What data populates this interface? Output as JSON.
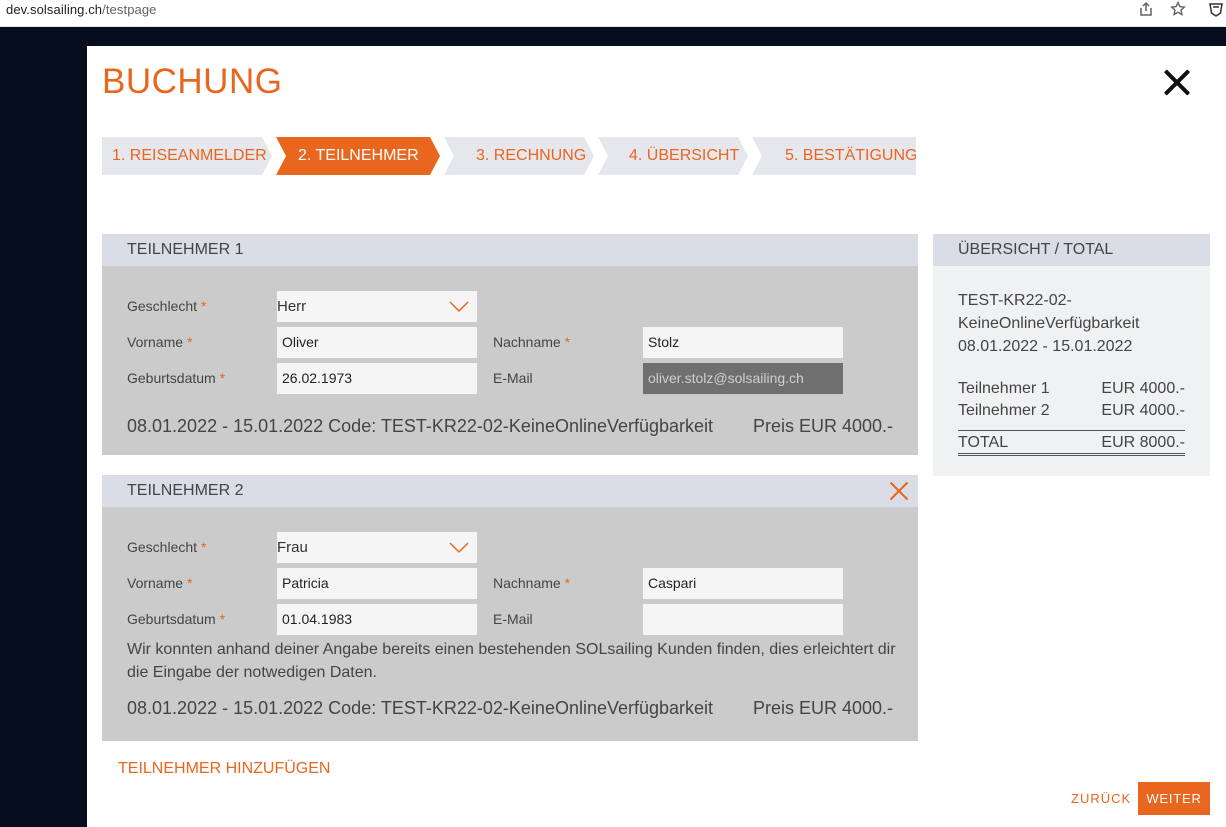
{
  "browser": {
    "url_host": "dev.solsailing.ch",
    "url_path": "/testpage"
  },
  "modal": {
    "title": "BUCHUNG"
  },
  "steps": [
    {
      "label": "1. REISEANMELDER"
    },
    {
      "label": "2. TEILNEHMER"
    },
    {
      "label": "3. RECHNUNG"
    },
    {
      "label": "4. ÜBERSICHT"
    },
    {
      "label": "5. BESTÄTIGUNG"
    }
  ],
  "labels": {
    "gender": "Geschlecht",
    "firstname": "Vorname",
    "lastname": "Nachname",
    "birthdate": "Geburtsdatum",
    "email": "E-Mail",
    "required_mark": "*"
  },
  "participants": [
    {
      "header": "TEILNEHMER 1",
      "gender": "Herr",
      "firstname": "Oliver",
      "lastname": "Stolz",
      "birthdate": "26.02.1973",
      "email": "oliver.stolz@solsailing.ch",
      "summary": "08.01.2022 - 15.01.2022 Code: TEST-KR22-02-KeineOnlineVerfügbarkeit",
      "price": "Preis EUR 4000.-"
    },
    {
      "header": "TEILNEHMER 2",
      "gender": "Frau",
      "firstname": "Patricia",
      "lastname": "Caspari",
      "birthdate": "01.04.1983",
      "email": "",
      "info": "Wir konnten anhand deiner Angabe bereits einen bestehenden SOLsailing Kunden finden, dies erleichtert dir die Eingabe der notwedigen Daten.",
      "summary": "08.01.2022 - 15.01.2022 Code: TEST-KR22-02-KeineOnlineVerfügbarkeit",
      "price": "Preis EUR 4000.-"
    }
  ],
  "overview": {
    "header": "ÜBERSICHT / TOTAL",
    "trip_line1": "TEST-KR22-02-",
    "trip_line2": "KeineOnlineVerfügbarkeit",
    "dates": "08.01.2022 - 15.01.2022",
    "rows": [
      {
        "label": "Teilnehmer 1",
        "amount": "EUR 4000.-"
      },
      {
        "label": "Teilnehmer 2",
        "amount": "EUR 4000.-"
      }
    ],
    "total_label": "TOTAL",
    "total_amount": "EUR 8000.-"
  },
  "actions": {
    "add_participant": "TEILNEHMER HINZUFÜGEN",
    "back": "ZURÜCK",
    "next": "WEITER"
  },
  "colors": {
    "accent": "#e8661e",
    "backdrop": "#050d1f",
    "panel": "#cbcbcb",
    "panel_header": "#dadde5"
  }
}
